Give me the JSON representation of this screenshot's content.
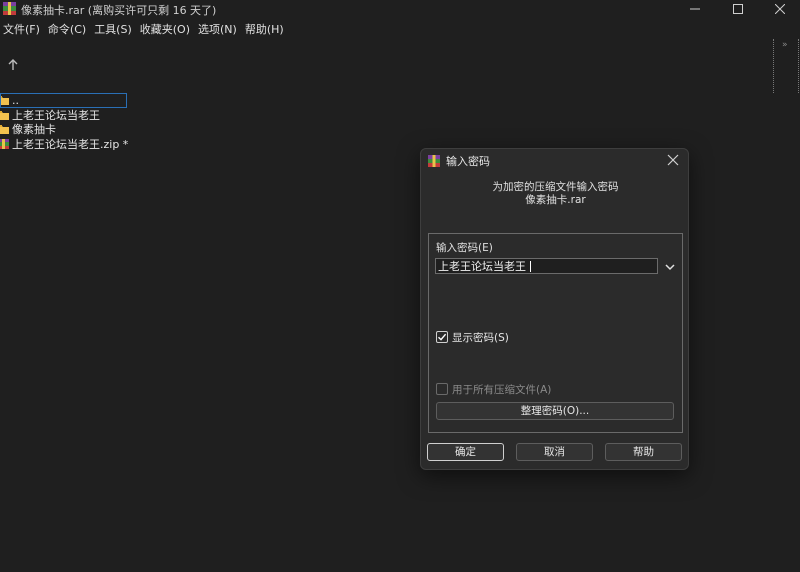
{
  "window": {
    "title": "像素抽卡.rar (离购买许可只剩 16 天了)",
    "icon": "winrar-icon"
  },
  "menu": [
    "文件(F)",
    "命令(C)",
    "工具(S)",
    "收藏夹(O)",
    "选项(N)",
    "帮助(H)"
  ],
  "files": [
    {
      "name": "..",
      "icon": "folder-icon",
      "selected": true
    },
    {
      "name": "上老王论坛当老王",
      "icon": "folder-icon"
    },
    {
      "name": "像素抽卡",
      "icon": "folder-icon"
    },
    {
      "name": "上老王论坛当老王.zip *",
      "icon": "winrar-icon"
    }
  ],
  "dialog": {
    "title": "输入密码",
    "line1": "为加密的压缩文件输入密码",
    "line2": "像素抽卡.rar",
    "password_label": "输入密码(E)",
    "password_value": "上老王论坛当老王",
    "show_password_label": "显示密码(S)",
    "show_password_checked": true,
    "use_all_label": "用于所有压缩文件(A)",
    "use_all_checked": false,
    "manage_label": "整理密码(O)...",
    "ok": "确定",
    "cancel": "取消",
    "help": "帮助"
  },
  "colors": {
    "background": "#1f1f1f",
    "dialog": "#2b2b2b",
    "selection": "#2a6fb5",
    "folder": "#f2c14e"
  }
}
